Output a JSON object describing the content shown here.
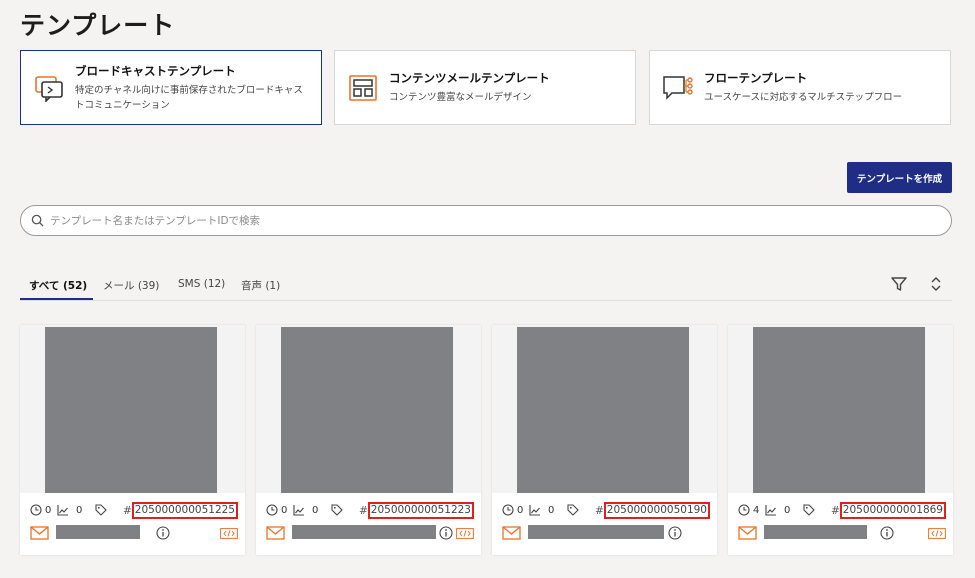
{
  "page": {
    "title": "テンプレート"
  },
  "template_types": [
    {
      "title": "ブロードキャストテンプレート",
      "description": "特定のチャネル向けに事前保存されたブロードキャストコミュニケーション",
      "icon": "broadcast-icon",
      "selected": true
    },
    {
      "title": "コンテンツメールテンプレート",
      "description": "コンテンツ豊富なメールデザイン",
      "icon": "content-layout-icon",
      "selected": false
    },
    {
      "title": "フローテンプレート",
      "description": "ユースケースに対応するマルチステップフロー",
      "icon": "flow-icon",
      "selected": false
    }
  ],
  "actions": {
    "create_label": "テンプレートを作成"
  },
  "search": {
    "placeholder": "テンプレート名またはテンプレートIDで検索"
  },
  "tabs": [
    {
      "label": "すべて (52)",
      "active": true
    },
    {
      "label": "メール (39)",
      "active": false
    },
    {
      "label": "SMS (12)",
      "active": false
    },
    {
      "label": "音声 (1)",
      "active": false
    }
  ],
  "cards": [
    {
      "clock_count": "0",
      "chart_count": "0",
      "id_prefix": "#",
      "id": "205000000051225",
      "channel_icon": "mail-icon"
    },
    {
      "clock_count": "0",
      "chart_count": "0",
      "id_prefix": "#",
      "id": "205000000051223",
      "channel_icon": "mail-icon"
    },
    {
      "clock_count": "0",
      "chart_count": "0",
      "id_prefix": "#",
      "id": "205000000050190",
      "channel_icon": "mail-icon"
    },
    {
      "clock_count": "4",
      "chart_count": "0",
      "id_prefix": "#",
      "id": "205000000001869",
      "channel_icon": "mail-icon"
    }
  ],
  "colors": {
    "primary": "#1f2d84",
    "accent_orange": "#e8742a",
    "highlight_red": "#e02020",
    "placeholder_gray": "#808184"
  }
}
